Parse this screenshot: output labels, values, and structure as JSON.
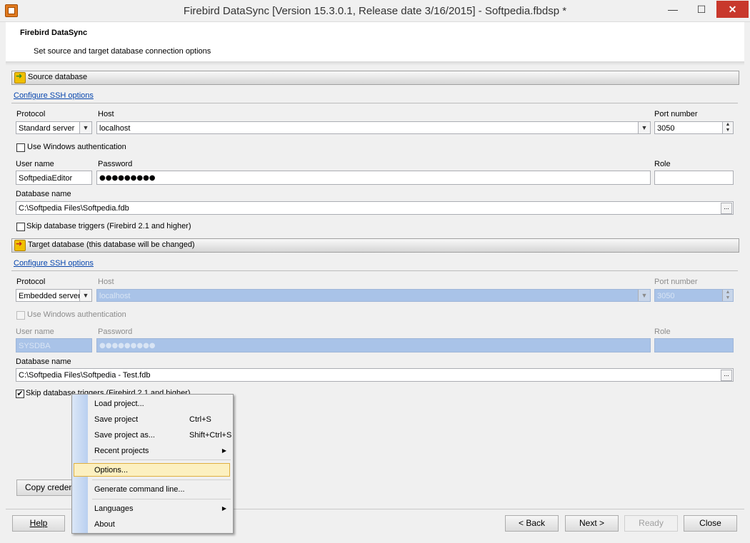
{
  "window": {
    "title": "Firebird DataSync [Version 15.3.0.1, Release date 3/16/2015] - Softpedia.fbdsp *",
    "minimize": "—",
    "maximize": "☐",
    "close": "✕"
  },
  "header": {
    "title": "Firebird DataSync",
    "subtitle": "Set source and target database connection options"
  },
  "source": {
    "section_label": "Source database",
    "ssh_link": "Configure SSH options",
    "protocol_label": "Protocol",
    "protocol_value": "Standard server",
    "host_label": "Host",
    "host_value": "localhost",
    "port_label": "Port number",
    "port_value": "3050",
    "win_auth_label": "Use Windows authentication",
    "user_label": "User name",
    "user_value": "SoftpediaEditor",
    "password_label": "Password",
    "password_value": "●●●●●●●●●",
    "role_label": "Role",
    "role_value": "",
    "dbname_label": "Database name",
    "dbname_value": "C:\\Softpedia Files\\Softpedia.fdb",
    "skip_triggers_label": "Skip database triggers (Firebird 2.1 and higher)"
  },
  "target": {
    "section_label": "Target database (this database will be changed)",
    "ssh_link": "Configure SSH options",
    "protocol_label": "Protocol",
    "protocol_value": "Embedded server",
    "host_label": "Host",
    "host_value": "localhost",
    "port_label": "Port number",
    "port_value": "3050",
    "win_auth_label": "Use Windows authentication",
    "user_label": "User name",
    "user_value": "SYSDBA",
    "password_label": "Password",
    "password_value": "●●●●●●●●●",
    "role_label": "Role",
    "role_value": "",
    "dbname_label": "Database name",
    "dbname_value": "C:\\Softpedia Files\\Softpedia - Test.fdb",
    "skip_triggers_label": "Skip database triggers (Firebird 2.1 and higher)",
    "skip_triggers_checked": "✔"
  },
  "copy_button": "Copy credent",
  "footer": {
    "help": "Help",
    "back": "< Back",
    "next": "Next >",
    "ready": "Ready",
    "close": "Close"
  },
  "menu": {
    "load": "Load project...",
    "save": "Save project",
    "save_sc": "Ctrl+S",
    "save_as": "Save project as...",
    "save_as_sc": "Shift+Ctrl+S",
    "recent": "Recent projects",
    "options": "Options...",
    "generate": "Generate command line...",
    "languages": "Languages",
    "about": "About",
    "submenu_arrow": "▶"
  },
  "colors": {
    "close_button": "#c8382c",
    "link": "#0645ad",
    "disabled_field": "#a9c3e8",
    "menu_highlight": "#fcf0c0"
  }
}
